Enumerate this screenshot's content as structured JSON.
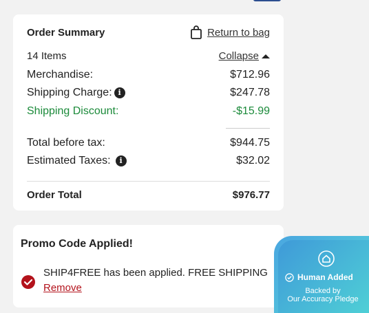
{
  "order_summary": {
    "title": "Order Summary",
    "return_link": "Return to bag",
    "items_count": "14 Items",
    "collapse_label": "Collapse",
    "merchandise_label": "Merchandise:",
    "merchandise_value": "$712.96",
    "shipping_label": "Shipping Charge:",
    "shipping_value": "$247.78",
    "discount_label": "Shipping Discount:",
    "discount_value": "-$15.99",
    "before_tax_label": "Total before tax:",
    "before_tax_value": "$944.75",
    "taxes_label": "Estimated Taxes:",
    "taxes_value": "$32.02",
    "total_label": "Order Total",
    "total_value": "$976.77"
  },
  "promo": {
    "title": "Promo Code Applied!",
    "message": "SHIP4FREE has been applied. FREE SHIPPING",
    "remove_label": "Remove"
  },
  "badge": {
    "title": "Human Added",
    "line1": "Backed by",
    "line2": "Our Accuracy Pledge"
  },
  "colors": {
    "discount_green": "#1b8a3a",
    "remove_red": "#b3121b",
    "badge_blue": "#3f9ad8"
  }
}
